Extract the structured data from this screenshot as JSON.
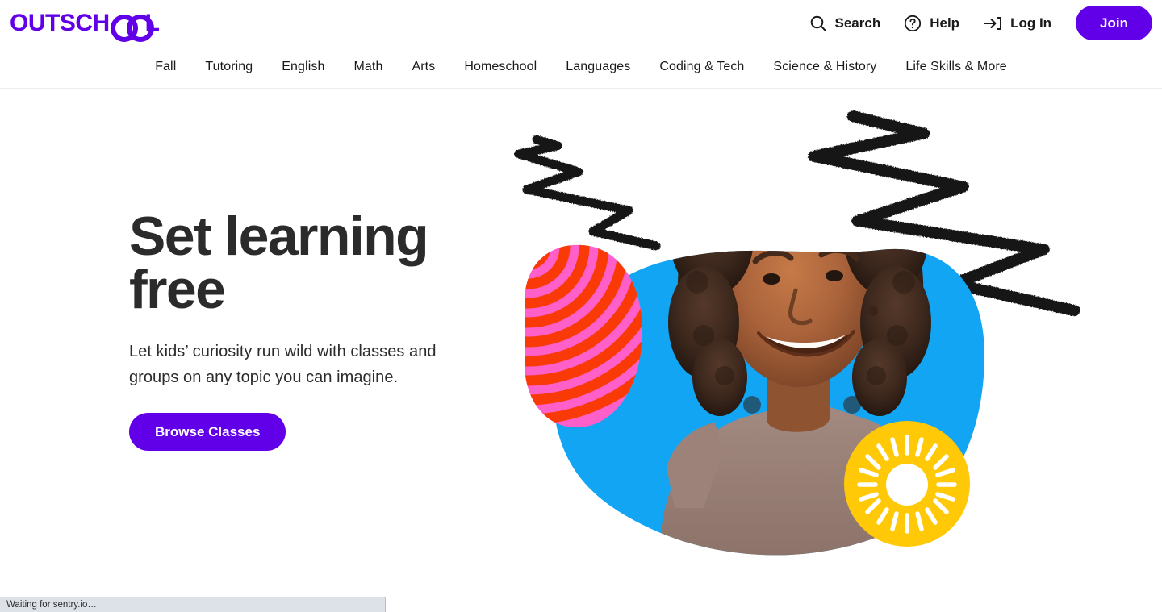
{
  "brand": {
    "name": "OUTSCHOOL",
    "name_part1": "OUTSCH",
    "name_part2": "L",
    "purple": "#6100E8"
  },
  "header": {
    "actions": [
      {
        "label": "Search",
        "icon": "search-icon"
      },
      {
        "label": "Help",
        "icon": "help-circle-icon"
      },
      {
        "label": "Log In",
        "icon": "login-arrow-icon"
      }
    ],
    "join_label": "Join"
  },
  "nav": {
    "items": [
      {
        "label": "Fall"
      },
      {
        "label": "Tutoring"
      },
      {
        "label": "English"
      },
      {
        "label": "Math"
      },
      {
        "label": "Arts"
      },
      {
        "label": "Homeschool"
      },
      {
        "label": "Languages"
      },
      {
        "label": "Coding & Tech"
      },
      {
        "label": "Science & History"
      },
      {
        "label": "Life Skills & More"
      }
    ]
  },
  "hero": {
    "title_line1": "Set learning",
    "title_line2": "free",
    "subtitle": "Let kids’ curiosity run wild with classes and groups on any topic you can imagine.",
    "cta_label": "Browse Classes",
    "colors": {
      "blue_blob": "#12A5F4",
      "pink_stripes": "#FF5FC8",
      "orange_stripes": "#F93A07",
      "yellow_circle": "#FFC907",
      "scribble_black": "#141414",
      "heading": "#2b2b2b"
    },
    "art_description": "Smiling girl with curly hair"
  },
  "status_bar": {
    "text": "Waiting for sentry.io…"
  }
}
